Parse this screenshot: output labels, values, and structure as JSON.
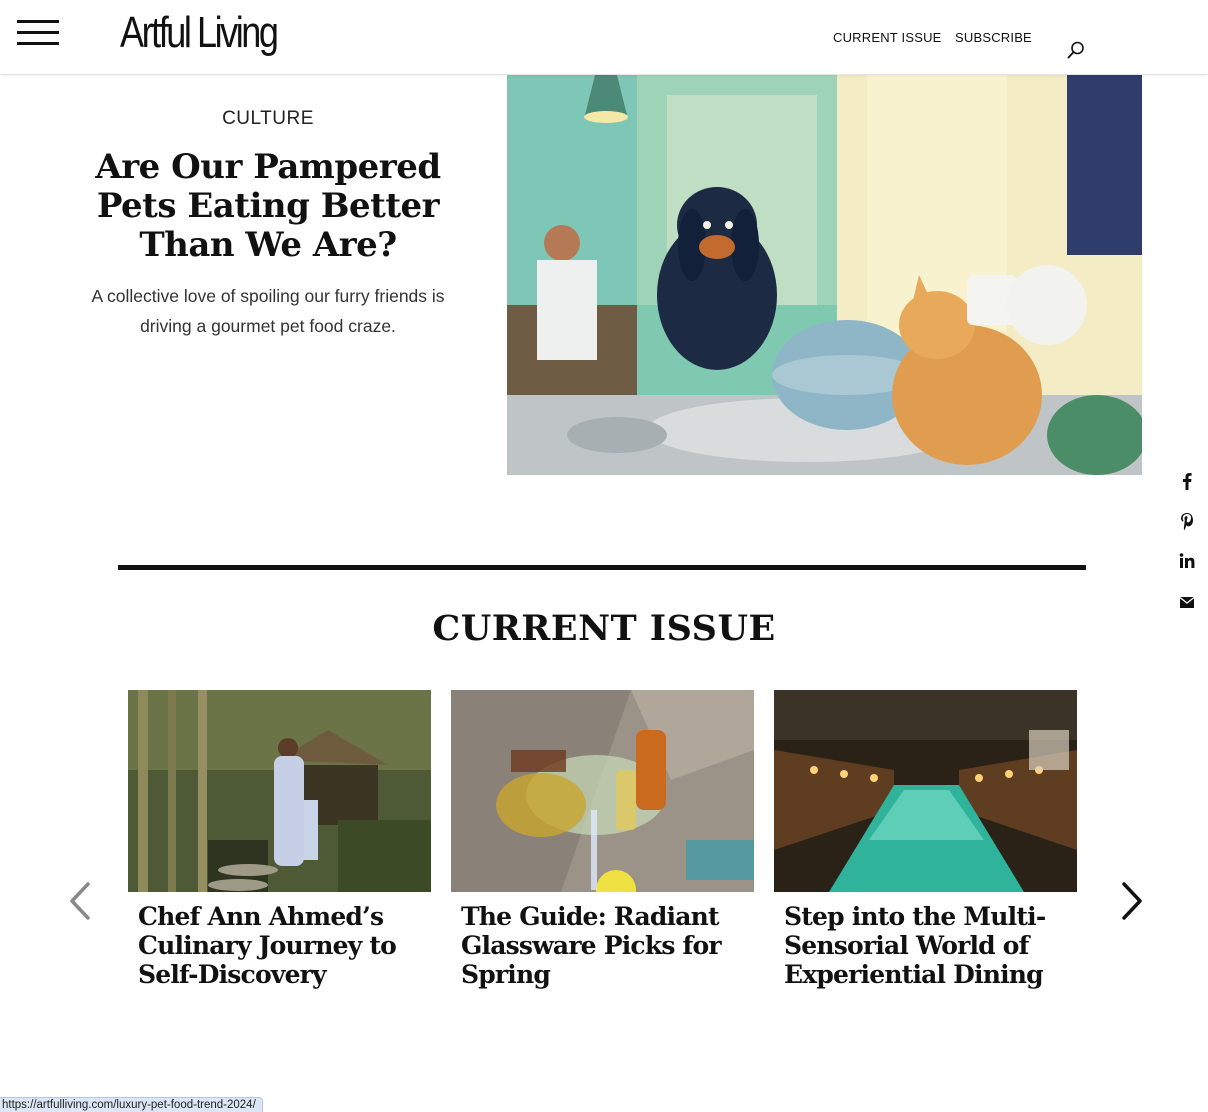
{
  "header": {
    "logo": "Artful Living",
    "nav": {
      "current_issue": "CURRENT ISSUE",
      "subscribe": "SUBSCRIBE"
    },
    "icons": [
      "hamburger-menu-icon",
      "search-icon"
    ]
  },
  "hero": {
    "category": "CULTURE",
    "title": "Are Our Pampered Pets Eating Better Than We Are?",
    "dek": "A collective love of spoiling our furry friends is driving a gourmet pet food craze."
  },
  "section": {
    "title": "CURRENT ISSUE"
  },
  "cards": [
    {
      "title": "Chef Ann Ahmed’s Culinary Journey to Self-Discovery"
    },
    {
      "title": "The Guide: Radiant Glassware Picks for Spring"
    },
    {
      "title": "Step into the Multi-Sensorial World of Experiential Dining"
    }
  ],
  "share": [
    "facebook-icon",
    "pinterest-icon",
    "linkedin-icon",
    "email-icon"
  ],
  "status_bar": {
    "url": "https://artfulliving.com/luxury-pet-food-trend-2024/"
  },
  "colors": {
    "text": "#111111",
    "divider": "#111111",
    "status_bar": "#dbe6f7"
  }
}
